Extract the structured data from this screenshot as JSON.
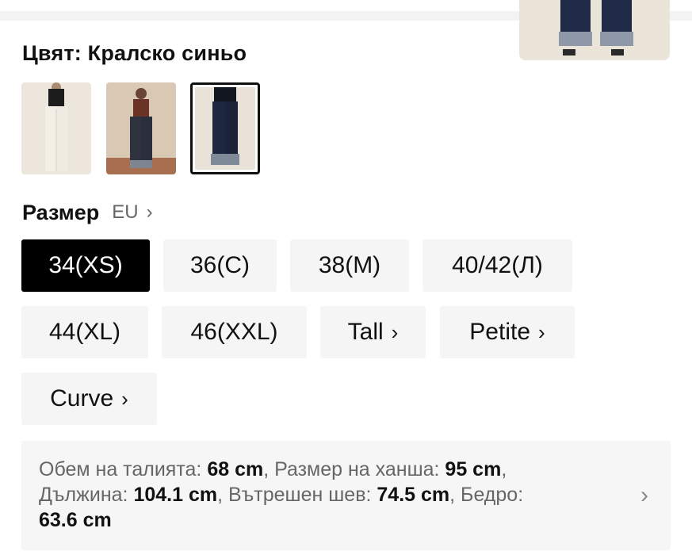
{
  "color_label": "Цвят: Кралско синьо",
  "swatches": [
    {
      "name": "swatch-white",
      "colors": {
        "bg": "#ece6dc",
        "top": "#1c1c1c",
        "pants": "#f1ece3"
      }
    },
    {
      "name": "swatch-brown-top-dark-jeans",
      "colors": {
        "bg": "#d9c8b3",
        "top": "#6b3325",
        "pants": "#2f3340"
      }
    },
    {
      "name": "swatch-royal-blue",
      "colors": {
        "bg": "#e8e2d8",
        "top": "#121620",
        "pants": "#1e2740"
      }
    }
  ],
  "size": {
    "title": "Размер",
    "region": "EU",
    "options": [
      {
        "label": "34(XS)",
        "selected": true
      },
      {
        "label": "36(С)",
        "selected": false
      },
      {
        "label": "38(М)",
        "selected": false
      },
      {
        "label": "40/42(Л)",
        "selected": false
      },
      {
        "label": "44(XL)",
        "selected": false
      },
      {
        "label": "46(XXL)",
        "selected": false
      },
      {
        "label": "Tall",
        "selected": false,
        "arrow": "›"
      },
      {
        "label": "Petite",
        "selected": false,
        "arrow": "›"
      },
      {
        "label": "Curve",
        "selected": false,
        "arrow": "›"
      }
    ]
  },
  "measurements": {
    "waist_label": "Обем на талията: ",
    "waist_value": "68 cm",
    "sep1": ", ",
    "hip_label": "Размер на ханша: ",
    "hip_value": "95 cm",
    "sep2": ",",
    "length_label": "Дължина: ",
    "length_value": "104.1 cm",
    "sep3": ", ",
    "inseam_label": "Вътрешен шев: ",
    "inseam_value": "74.5 cm",
    "sep4": ", ",
    "thigh_label": "Бедро: ",
    "thigh_value": "63.6 cm"
  },
  "icons": {
    "chevron": "›"
  }
}
